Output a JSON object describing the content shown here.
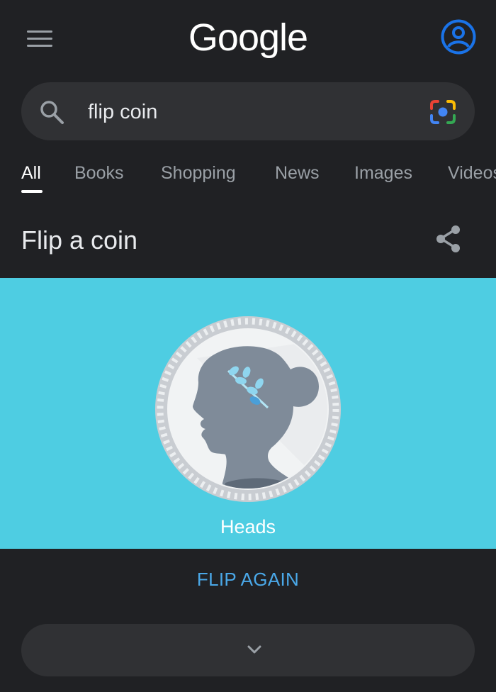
{
  "header": {
    "logo_text": "Google",
    "menu_icon": "hamburger-menu-icon",
    "account_icon": "account-circle-icon"
  },
  "search": {
    "query": "flip coin",
    "search_icon": "search-icon",
    "lens_icon": "google-lens-camera-icon"
  },
  "tabs": {
    "items": [
      "All",
      "Books",
      "Shopping",
      "News",
      "Images",
      "Videos"
    ],
    "active": "All"
  },
  "card": {
    "title": "Flip a coin",
    "share_icon": "share-icon",
    "result": "Heads",
    "flip_again_label": "FLIP AGAIN",
    "expand_icon": "chevron-down-icon"
  },
  "colors": {
    "background": "#202124",
    "surface": "#303134",
    "coin_panel": "#4ecde2",
    "link_blue": "#4aa8e8",
    "account_blue": "#1a73e8"
  }
}
